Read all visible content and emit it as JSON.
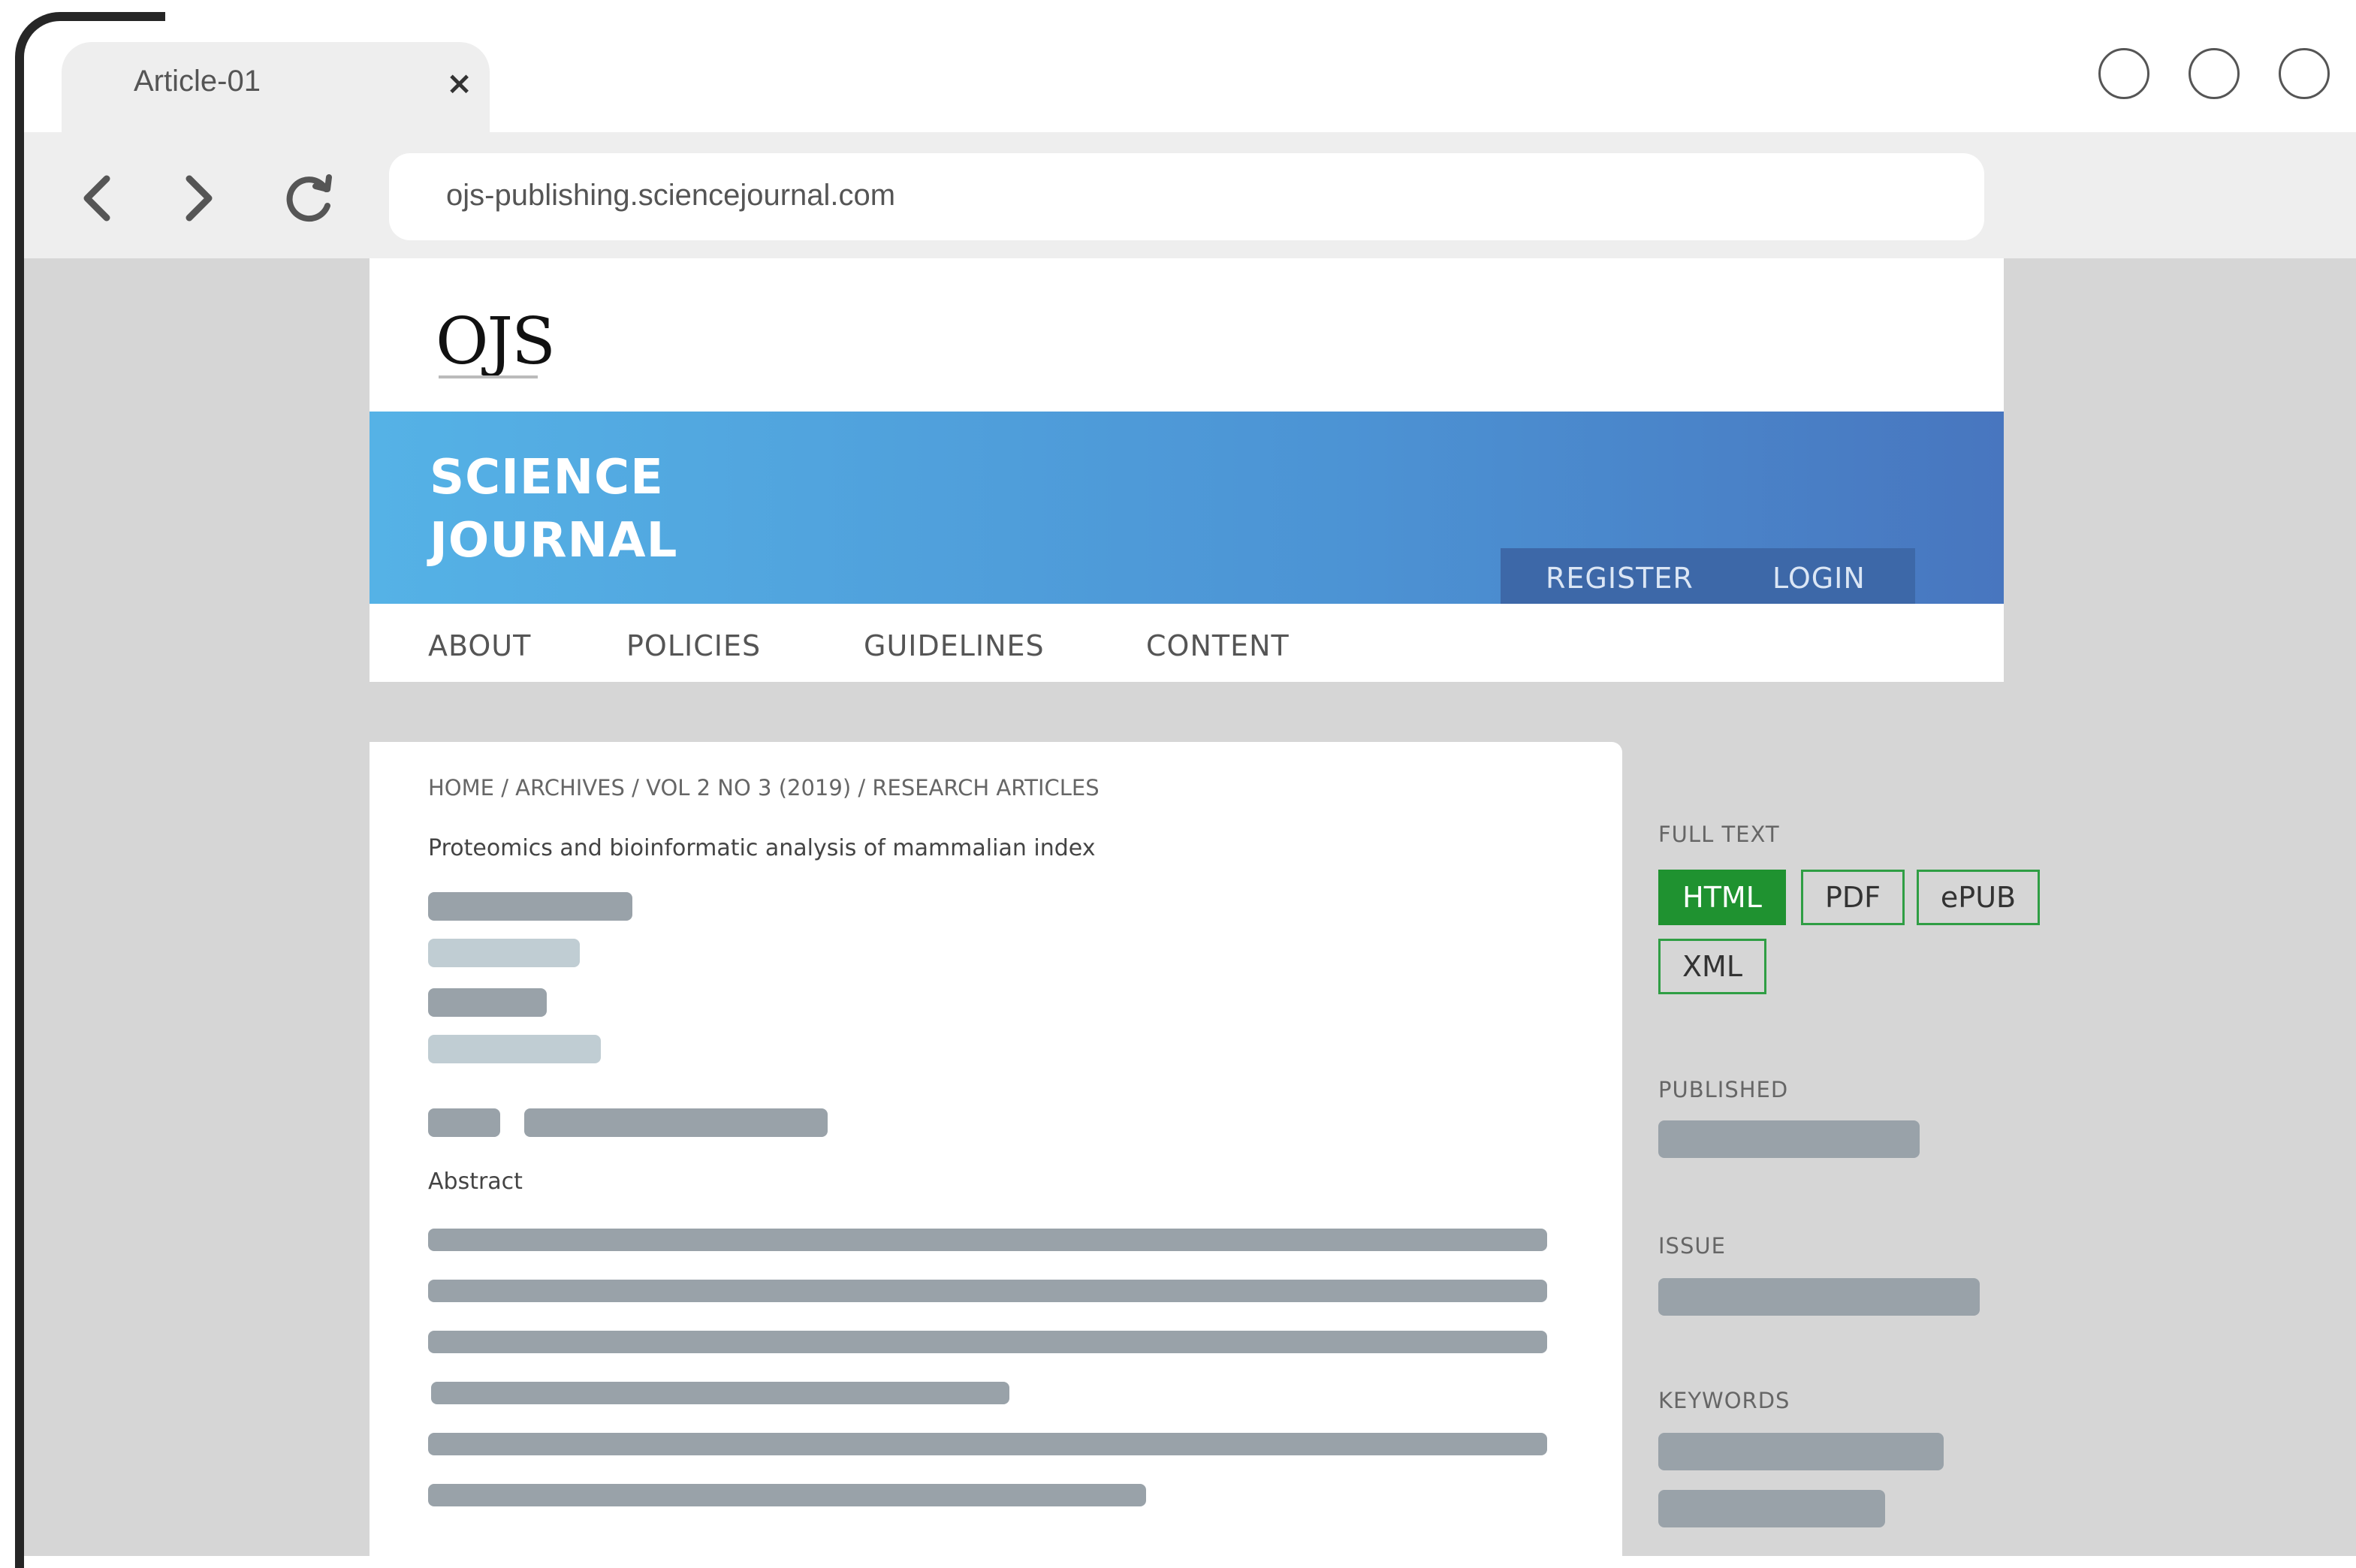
{
  "browser": {
    "tab": {
      "title": "Article-01",
      "close_glyph": "×"
    },
    "address_bar": {
      "url": "ojs-publishing.sciencejournal.com"
    },
    "icons": [
      "back-icon",
      "forward-icon",
      "reload-icon",
      "close-icon"
    ]
  },
  "site": {
    "logo_text": "OJS",
    "journal_title_line1": "SCIENCE",
    "journal_title_line2": "JOURNAL",
    "auth": {
      "register": "REGISTER",
      "login": "LOGIN"
    },
    "nav": {
      "about": "ABOUT",
      "policies": "POLICIES",
      "guidelines": "GUIDELINES",
      "content": "CONTENT"
    },
    "colors": {
      "banner_start": "#55b2e6",
      "banner_end": "#4876bf",
      "auth_bg": "#3d68a8",
      "accent_green": "#1f9230"
    }
  },
  "article": {
    "breadcrumb": "HOME / ARCHIVES / VOL 2 NO 3 (2019) / RESEARCH ARTICLES",
    "title": "Proteomics and bioinformatic analysis of mammalian index",
    "abstract_label": "Abstract"
  },
  "sidebar": {
    "full_text_label": "FULL TEXT",
    "formats": {
      "html": "HTML",
      "pdf": "PDF",
      "epub": "ePUB",
      "xml": "XML"
    },
    "published_label": "PUBLISHED",
    "issue_label": "ISSUE",
    "keywords_label": "KEYWORDS"
  }
}
